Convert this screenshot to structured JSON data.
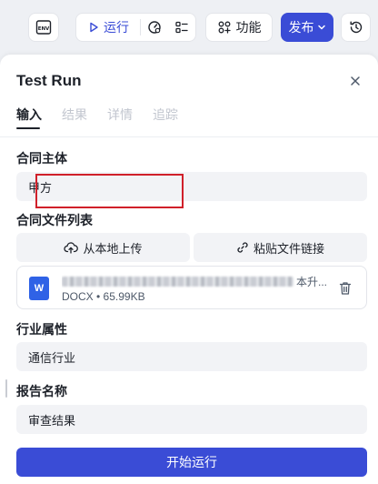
{
  "toolbar": {
    "env_label": "ENV",
    "run_label": "运行",
    "function_label": "功能",
    "publish_label": "发布"
  },
  "panel": {
    "title": "Test Run",
    "tabs": [
      {
        "label": "输入",
        "active": true
      },
      {
        "label": "结果",
        "active": false
      },
      {
        "label": "详情",
        "active": false
      },
      {
        "label": "追踪",
        "active": false
      }
    ]
  },
  "form": {
    "contract_party": {
      "label": "合同主体",
      "value": "甲方"
    },
    "contract_files": {
      "label": "合同文件列表",
      "upload_local_label": "从本地上传",
      "paste_link_label": "粘贴文件链接",
      "file": {
        "name_suffix": "本升...",
        "meta": "DOCX • 65.99KB",
        "icon_letter": "W"
      }
    },
    "industry": {
      "label": "行业属性",
      "value": "通信行业"
    },
    "report_name": {
      "label": "报告名称",
      "value": "审查结果"
    }
  },
  "start_button_label": "开始运行",
  "colors": {
    "primary": "#3a4cd6",
    "highlight_border": "#d0202a",
    "file_icon": "#2f62e6"
  }
}
